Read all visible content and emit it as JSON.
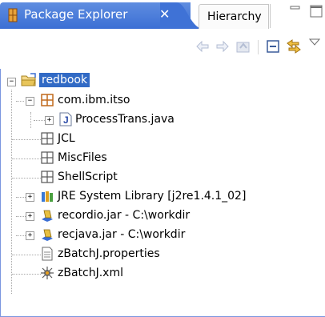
{
  "tabs": {
    "active_label": "Package Explorer",
    "close_glyph": "✕",
    "inactive_label": "Hierarchy"
  },
  "toolbar": {
    "back_icon": "back-arrow-icon",
    "forward_icon": "forward-arrow-icon",
    "up_icon": "go-up-icon",
    "collapse_icon": "collapse-all-icon",
    "link_icon": "link-with-editor-icon",
    "menu_icon": "view-menu-icon"
  },
  "tree": {
    "project": "redbook",
    "package": "com.ibm.itso",
    "java_file": "ProcessTrans.java",
    "folder_jcl": "JCL",
    "folder_misc": "MiscFiles",
    "folder_shell": "ShellScript",
    "jre_library": "JRE System Library [j2re1.4.1_02]",
    "jar_recordio": "recordio.jar - C:\\workdir",
    "jar_recjava": "recjava.jar - C:\\workdir",
    "file_properties": "zBatchJ.properties",
    "file_xml": "zBatchJ.xml",
    "expander_minus": "−",
    "expander_plus": "+"
  },
  "colors": {
    "tab_active": "#4a7ddb",
    "selection": "#316ac5",
    "package_icon": "#c0681a"
  }
}
